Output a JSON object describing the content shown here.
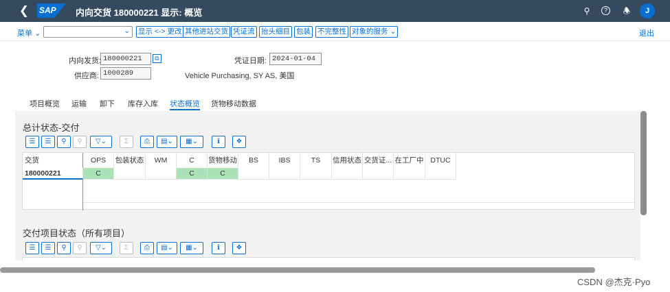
{
  "shell": {
    "title": "内向交货 180000221 显示: 概览",
    "logo": "SAP",
    "avatar": "J",
    "icons": [
      "back-icon",
      "search-icon",
      "help-icon",
      "bell-icon"
    ]
  },
  "toolbar": {
    "menu": "菜单",
    "exit": "退出",
    "buttons": [
      "显示 <-> 更改",
      "其他进站交货",
      "凭证流",
      "抬头细目",
      "包装",
      "不完整性",
      "对象的服务"
    ]
  },
  "header": {
    "inbound_label": "内向发货:",
    "inbound_value": "180000221",
    "vendor_label": "供应商:",
    "vendor_value": "1000289",
    "date_label": "凭证日期:",
    "date_value": "2024-01-04",
    "vendor_name": "Vehicle Purchasing, SY AS, 美国"
  },
  "tabs": [
    "项目概览",
    "运输",
    "卸下",
    "库存入库",
    "状态概览",
    "货物移动数据"
  ],
  "tabs_selected": "状态概览",
  "section1": {
    "title": "总计状态-交付",
    "columns": [
      "交货",
      "OPS",
      "包装状态",
      "WM",
      "C",
      "货物移动",
      "BS",
      "IBS",
      "TS",
      "信用状态",
      "交货证...",
      "在工厂中",
      "DTUC"
    ],
    "row": [
      "180000221",
      "C",
      "",
      "",
      "C",
      "C",
      "",
      "",
      "",
      "",
      "",
      "",
      ""
    ]
  },
  "section2": {
    "title": "交付项目状态（所有项目）"
  },
  "watermark": "CSDN @杰克·Pyo",
  "colors": {
    "shell": "#354a5f",
    "accent": "#0a6ed1",
    "status_green": "#abe2b8"
  }
}
